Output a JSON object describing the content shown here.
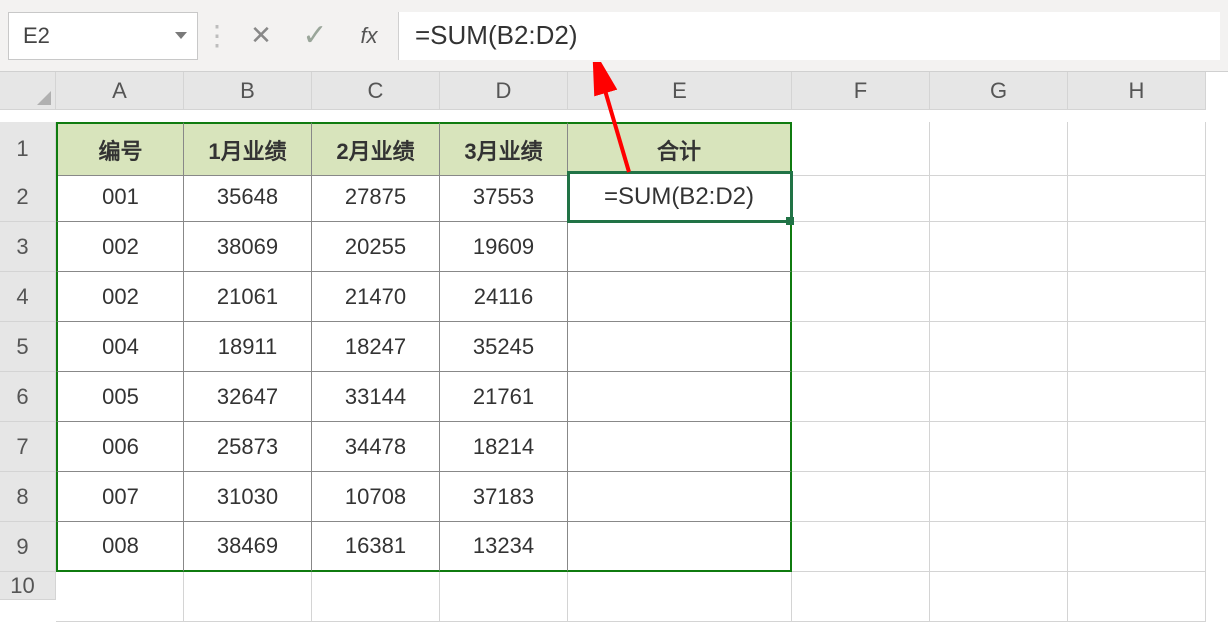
{
  "formula_bar": {
    "cell_ref": "E2",
    "cancel_glyph": "✕",
    "enter_glyph": "✓",
    "fx_label": "fx",
    "formula": "=SUM(B2:D2)"
  },
  "columns": [
    "A",
    "B",
    "C",
    "D",
    "E",
    "F",
    "G",
    "H"
  ],
  "row_numbers": [
    "1",
    "2",
    "3",
    "4",
    "5",
    "6",
    "7",
    "8",
    "9",
    "10"
  ],
  "headers": {
    "A": "编号",
    "B": "1月业绩",
    "C": "2月业绩",
    "D": "3月业绩",
    "E": "合计"
  },
  "active_cell_display": "=SUM(B2:D2)",
  "data": [
    {
      "id": "001",
      "m1": "35648",
      "m2": "27875",
      "m3": "37553"
    },
    {
      "id": "002",
      "m1": "38069",
      "m2": "20255",
      "m3": "19609"
    },
    {
      "id": "002",
      "m1": "21061",
      "m2": "21470",
      "m3": "24116"
    },
    {
      "id": "004",
      "m1": "18911",
      "m2": "18247",
      "m3": "35245"
    },
    {
      "id": "005",
      "m1": "32647",
      "m2": "33144",
      "m3": "21761"
    },
    {
      "id": "006",
      "m1": "25873",
      "m2": "34478",
      "m3": "18214"
    },
    {
      "id": "007",
      "m1": "31030",
      "m2": "10708",
      "m3": "37183"
    },
    {
      "id": "008",
      "m1": "38469",
      "m2": "16381",
      "m3": "13234"
    }
  ]
}
